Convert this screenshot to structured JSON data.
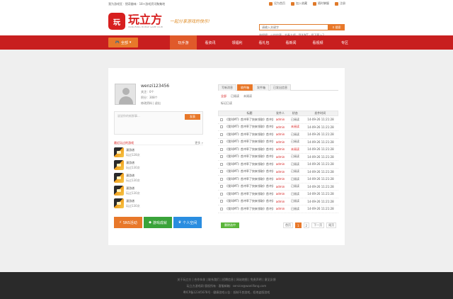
{
  "topbar": {
    "tagline": "我为游戏狂 · 猎奇趣味 · 18+游戏资讯聚集地",
    "links": [
      "设为首页",
      "加入收藏",
      "随时掌握",
      "注册"
    ]
  },
  "header": {
    "logo_mark": "玩",
    "logo_cn": "玩立方",
    "logo_en": "WANLIFANG MOBILE GAME CLUB",
    "slogan": "一起分享游戏的快乐!",
    "search_placeholder": "请输入关键字",
    "search_button": "搜索",
    "hot_words": "热搜榜：火焰纹章 · 节奏大师 · 我叫MT · 保卫萝卜2"
  },
  "nav": {
    "all_games": "全部",
    "items": [
      "玩手游",
      "看资讯",
      "领福利",
      "看礼包",
      "看新闻",
      "看视频",
      "专区"
    ]
  },
  "profile": {
    "username": "wenzi123456",
    "follow": "关注：0个",
    "points": "积分：308个",
    "actions": "修改资料 | 退出",
    "post_placeholder": "说说你的新鲜事...",
    "post_button": "发表"
  },
  "recent": {
    "title": "最近玩过的游戏",
    "more": "更多 »",
    "games": [
      {
        "name": "漫游谱",
        "played": "玩过128次"
      },
      {
        "name": "漫游谱",
        "played": "玩过130次"
      },
      {
        "name": "漫游谱",
        "played": "玩过130次"
      },
      {
        "name": "漫游谱",
        "played": "玩过130次"
      },
      {
        "name": "漫游谱",
        "played": "玩过130次"
      }
    ]
  },
  "big_buttons": [
    "SNS活动",
    "游戏成就",
    "个人空间"
  ],
  "messages": {
    "tabs": [
      "写新消息",
      "收件箱",
      "发件箱",
      "已发出信息"
    ],
    "subtabs": [
      "全部",
      "已阅读",
      "未阅读"
    ],
    "mark_read": "标记已读",
    "columns": [
      "标题",
      "发件人",
      "状态",
      "发件时间"
    ],
    "rows": [
      {
        "title": "《我叫MT》首冲率了快来领取》首冲奖励",
        "sender": "admin",
        "status": "已阅读",
        "time": "14-09-26 11:21:28",
        "unread": false
      },
      {
        "title": "《我叫MT》首冲率了快来领取》首冲奖励",
        "sender": "admin",
        "status": "未阅读",
        "time": "14-09-26 11:21:28",
        "unread": true
      },
      {
        "title": "《我叫MT》首冲率了快来领取》首冲奖励",
        "sender": "admin",
        "status": "已阅读",
        "time": "14-09-26 11:21:28",
        "unread": false
      },
      {
        "title": "《我叫MT》首冲率了快来领取》首冲奖励",
        "sender": "admin",
        "status": "已阅读",
        "time": "14-09-26 11:21:28",
        "unread": false
      },
      {
        "title": "《我叫MT》首冲率了快来领取》首冲奖励",
        "sender": "admin",
        "status": "未阅读",
        "time": "14-09-26 11:21:28",
        "unread": true
      },
      {
        "title": "《我叫MT》首冲率了快来领取》首冲奖励",
        "sender": "admin",
        "status": "已阅读",
        "time": "14-09-26 11:21:28",
        "unread": false
      },
      {
        "title": "《我叫MT》首冲率了快来领取》首冲奖励",
        "sender": "admin",
        "status": "已阅读",
        "time": "14-09-26 11:21:28",
        "unread": false
      },
      {
        "title": "《我叫MT》首冲率了快来领取》首冲奖励",
        "sender": "admin",
        "status": "已阅读",
        "time": "14-09-26 11:21:28",
        "unread": false
      },
      {
        "title": "《我叫MT》首冲率了快来领取》首冲奖励",
        "sender": "admin",
        "status": "已阅读",
        "time": "14-09-26 11:21:28",
        "unread": false
      },
      {
        "title": "《我叫MT》首冲率了快来领取》首冲奖励",
        "sender": "admin",
        "status": "已阅读",
        "time": "14-09-26 11:21:28",
        "unread": false
      },
      {
        "title": "《我叫MT》首冲率了快来领取》首冲奖励",
        "sender": "admin",
        "status": "已阅读",
        "time": "14-09-26 11:21:28",
        "unread": false
      },
      {
        "title": "《我叫MT》首冲率了快来领取》首冲奖励",
        "sender": "admin",
        "status": "已阅读",
        "time": "14-09-26 11:21:28",
        "unread": false
      },
      {
        "title": "《我叫MT》首冲率了快来领取》首冲奖励",
        "sender": "admin",
        "status": "已阅读",
        "time": "14-09-26 11:21:28",
        "unread": false
      }
    ],
    "delete_button": "删除选中",
    "pager": [
      "首页",
      "1",
      "2",
      "下一页",
      "尾页"
    ]
  },
  "footer": {
    "line1": "关于玩立方 | 合作伙伴 | 联系我们 | 招聘信息 | 网站地图 | 免责声明 | 意见反馈",
    "line2": "玩立方游戏网 版权所有 · 客服邮箱：service@wanlifang.com",
    "line3": "粤ICP备12345678号 · 健康游戏公告：抵制不良游戏，拒绝盗版游戏"
  },
  "colors": {
    "brand_red": "#c81f1f",
    "accent_orange": "#e8782a"
  }
}
